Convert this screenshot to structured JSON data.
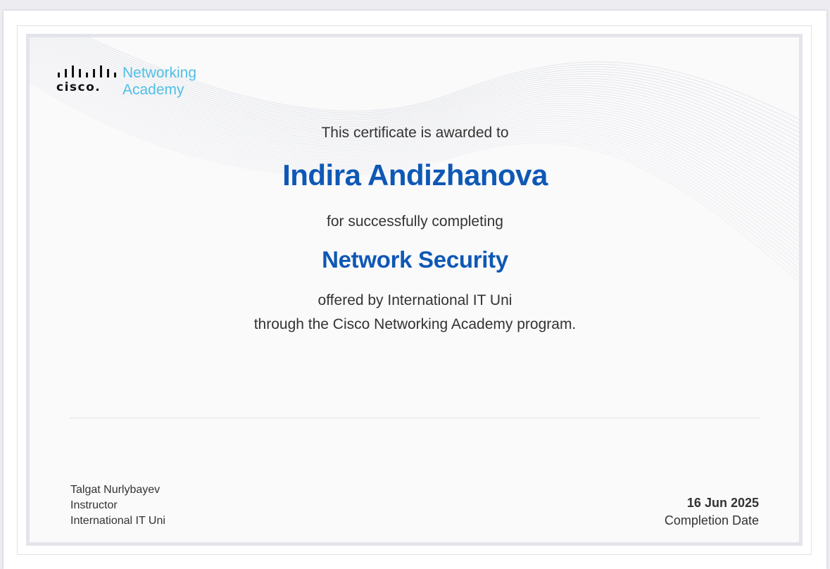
{
  "logo": {
    "brand": "cisco.",
    "line1": "Networking",
    "line2": "Academy",
    "brand_color": "#4fbfe6"
  },
  "certificate": {
    "awarded_text": "This certificate is awarded to",
    "recipient": "Indira Andizhanova",
    "completing_text": "for successfully completing",
    "course": "Network Security",
    "offered_by": "offered by International IT Uni",
    "program_text": "through the Cisco Networking Academy program.",
    "accent_color": "#0f58b5"
  },
  "instructor": {
    "name": "Talgat Nurlybayev",
    "role": "Instructor",
    "organization": "International IT Uni"
  },
  "completion": {
    "date": "16 Jun 2025",
    "label": "Completion Date"
  }
}
